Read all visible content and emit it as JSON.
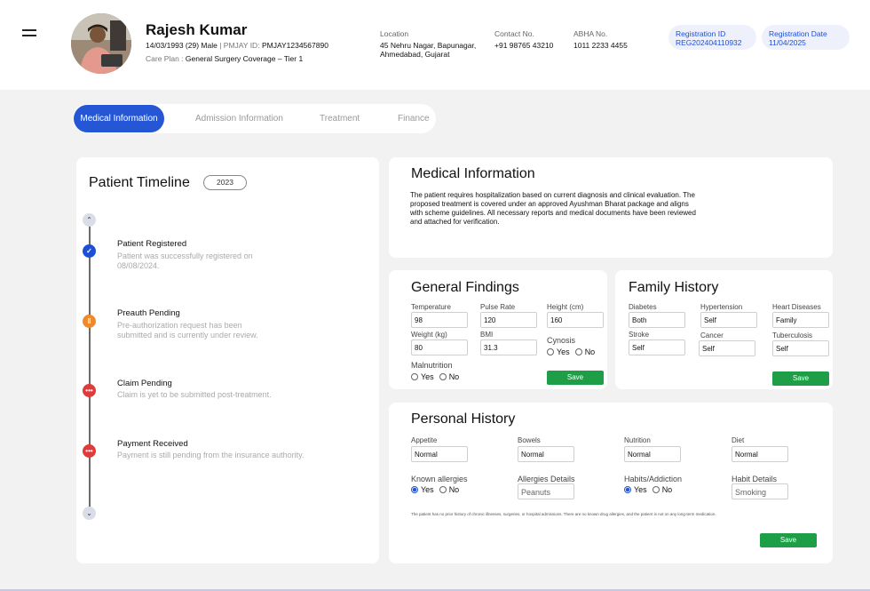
{
  "header": {
    "patient_name": "Rajesh Kumar",
    "dob_age_sex": "14/03/1993 (29) Male",
    "pmjay_label": "PMJAY ID:",
    "pmjay_id": "PMJAY1234567890",
    "care_plan_label": "Care Plan :",
    "care_plan": "General Surgery Coverage – Tier 1",
    "location_label": "Location",
    "location_line1": "45 Nehru Nagar, Bapunagar,",
    "location_line2": "Ahmedabad, Gujarat",
    "contact_label": "Contact No.",
    "contact": "+91 98765 43210",
    "abha_label": "ABHA No.",
    "abha": "1011 2233 4455",
    "reg_id_label": "Registration ID",
    "reg_id": "REG202404110932",
    "reg_date_label": "Registration  Date",
    "reg_date": "11/04/2025"
  },
  "tabs": [
    "Medical Information",
    "Admission Information",
    "Treatment",
    "Finance"
  ],
  "timeline": {
    "title": "Patient Timeline",
    "year": "2023",
    "items": [
      {
        "title": "Patient Registered",
        "desc": "Patient was successfully registered on 08/08/2024.",
        "status": "done",
        "glyph": "✓",
        "color": "#1d4ed8"
      },
      {
        "title": "Preauth Pending",
        "desc": "Pre-authorization request has been submitted and is currently under review.",
        "status": "pending",
        "glyph": "‖",
        "color": "#f0892b"
      },
      {
        "title": "Claim Pending",
        "desc": "Claim is yet to be submitted post-treatment.",
        "status": "waiting",
        "glyph": "•••",
        "color": "#e03a3a"
      },
      {
        "title": "Payment Received",
        "desc": "Payment is still pending from the insurance authority.",
        "status": "waiting",
        "glyph": "•••",
        "color": "#e03a3a"
      }
    ],
    "up_icon": "chevron-up-icon",
    "down_icon": "chevron-down-icon"
  },
  "medical": {
    "title": "Medical Information",
    "text": "The patient requires hospitalization based on current diagnosis and clinical evaluation. The proposed treatment is covered under an approved Ayushman Bharat package and aligns with scheme guidelines. All necessary reports and medical documents have been reviewed and attached for verification."
  },
  "general": {
    "title": "General Findings",
    "temperature_label": "Temperature",
    "temperature": "98",
    "pulse_label": "Pulse Rate",
    "pulse": "120",
    "height_label": "Height (cm)",
    "height": "160",
    "weight_label": "Weight (kg)",
    "weight": "80",
    "bmi_label": "BMI",
    "bmi": "31.3",
    "cynosis_label": "Cynosis",
    "malnutrition_label": "Malnutrition",
    "yes": "Yes",
    "no": "No",
    "save": "Save"
  },
  "family": {
    "title": "Family History",
    "diabetes_label": "Diabetes",
    "diabetes": "Both",
    "hypertension_label": "Hypertension",
    "hypertension": "Self",
    "heart_label": "Heart Diseases",
    "heart": "Family",
    "stroke_label": "Stroke",
    "stroke": "Self",
    "cancer_label": "Cancer",
    "cancer": "Self",
    "tb_label": "Tuberculosis",
    "tb": "Self",
    "save": "Save"
  },
  "personal": {
    "title": "Personal History",
    "appetite_label": "Appetite",
    "appetite": "Normal",
    "bowels_label": "Bowels",
    "bowels": "Normal",
    "nutrition_label": "Nutrition",
    "nutrition": "Normal",
    "diet_label": "Diet",
    "diet": "Normal",
    "allergies_label": "Known allergies",
    "allergy_details_label": "Allergies Details",
    "allergy_details_placeholder": "Peanuts",
    "habits_label": "Habits/Addiction",
    "habit_details_label": "Habit Details",
    "habit_details_placeholder": "Smoking",
    "yes": "Yes",
    "no": "No",
    "note": "The patient has no prior history of chronic illnesses, surgeries, or hospital admissions. There are no known drug allergies, and the patient is not on any long-term medication.",
    "save": "Save"
  }
}
